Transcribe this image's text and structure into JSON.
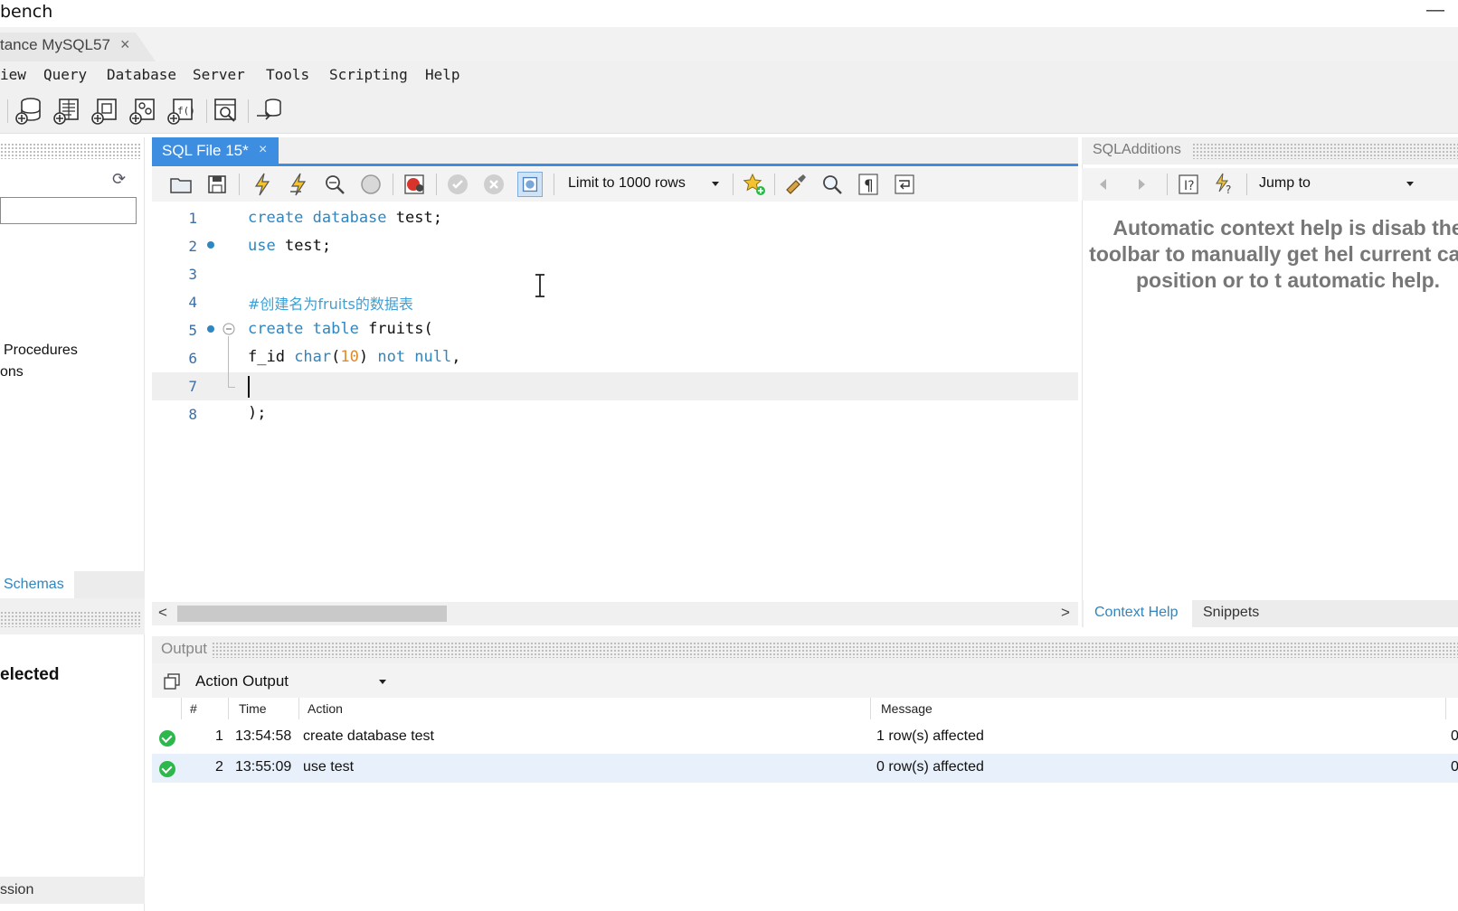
{
  "window": {
    "title": "bench",
    "minimize_glyph": "—"
  },
  "connection_tab": {
    "label": "tance MySQL57",
    "close_glyph": "×"
  },
  "menu": {
    "items": [
      "iew",
      "Query",
      "Database",
      "Server",
      "Tools",
      "Scripting",
      "Help"
    ]
  },
  "main_toolbar": {
    "icons": [
      "new-connection-icon",
      "open-sql-icon",
      "new-sql-tab-icon",
      "query-builder-icon",
      "sql-results-icon",
      "inspector-icon",
      "migration-icon"
    ]
  },
  "left_panel": {
    "refresh_glyph": "⟳",
    "items": [
      "Procedures",
      "ons"
    ],
    "schemas_tab": "Schemas",
    "info_text": "elected",
    "session_text": "ssion"
  },
  "editor": {
    "tab_label": "SQL File 15*",
    "tab_close": "×",
    "limit_select": "Limit to 1000 rows",
    "line_numbers": [
      "1",
      "2",
      "3",
      "4",
      "5",
      "6",
      "7",
      "8"
    ],
    "lines": {
      "l1_kw": "create database",
      "l1_rest": " test;",
      "l2_kw": "use",
      "l2_rest": " test;",
      "l4_comment": "#创建名为fruits的数据表",
      "l5_kw": "create table",
      "l5_rest": " fruits(",
      "l6_a": "f_id ",
      "l6_kw1": "char",
      "l6_b": "(",
      "l6_num": "10",
      "l6_c": ") ",
      "l6_kw2": "not null",
      "l6_d": ",",
      "l8": ");"
    },
    "scroll_left": "<",
    "scroll_right": ">"
  },
  "sql_additions": {
    "title": "SQLAdditions",
    "jump_select": "Jump to",
    "help_text": "Automatic context help is disab the toolbar to manually get hel current caret position or to t automatic help.",
    "tabs": [
      "Context Help",
      "Snippets"
    ]
  },
  "output": {
    "title": "Output",
    "select": "Action Output",
    "columns": [
      "#",
      "Time",
      "Action",
      "Message"
    ],
    "rows": [
      {
        "num": "1",
        "time": "13:54:58",
        "action": "create database test",
        "message": "1 row(s) affected",
        "extra": "0"
      },
      {
        "num": "2",
        "time": "13:55:09",
        "action": "use test",
        "message": "0 row(s) affected",
        "extra": "0"
      }
    ]
  },
  "colors": {
    "accent": "#3d8ee0",
    "keyword": "#2f86c0",
    "number": "#e08a2a",
    "success": "#2db84b"
  }
}
